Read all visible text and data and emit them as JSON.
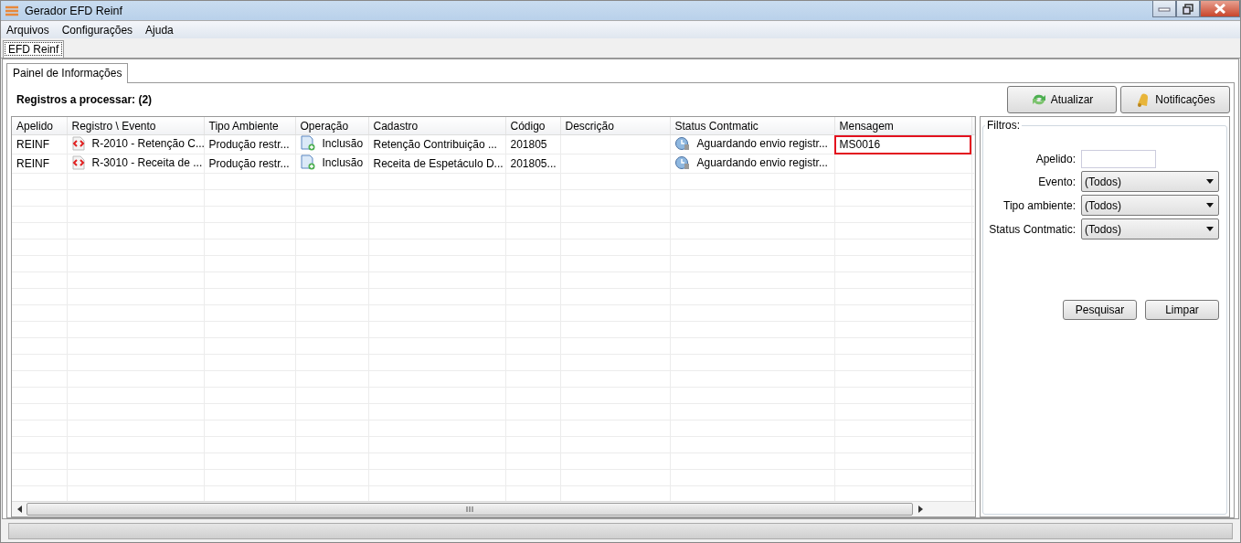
{
  "window": {
    "title": "Gerador EFD Reinf"
  },
  "menu": [
    "Arquivos",
    "Configurações",
    "Ajuda"
  ],
  "outer_tabs": [
    {
      "label": "EFD Reinf",
      "selected": true
    }
  ],
  "inner_tabs": [
    {
      "label": "Painel de Informações",
      "selected": true
    }
  ],
  "records_label": "Registros a processar: (2)",
  "toolbar_buttons": [
    {
      "label": "Atualizar",
      "kind": "refresh"
    },
    {
      "label": "Notificações",
      "kind": "bell"
    }
  ],
  "table": {
    "columns": [
      "Apelido",
      "Registro \\ Evento",
      "Tipo Ambiente",
      "Operação",
      "Cadastro",
      "Código",
      "Descrição",
      "Status Contmatic",
      "Mensagem"
    ],
    "rows": [
      {
        "apelido": "REINF",
        "registro": "R-2010 - Retenção C...",
        "tipo_ambiente": "Produção restr...",
        "operacao": "Inclusão",
        "cadastro": "Retenção Contribuição ...",
        "codigo": "201805",
        "status": "Aguardando envio registr...",
        "mensagem": "MS0016",
        "mensagem_outlined": true
      },
      {
        "apelido": "REINF",
        "registro": "R-3010 - Receita de ...",
        "tipo_ambiente": "Produção restr...",
        "operacao": "Inclusão",
        "cadastro": "Receita de Espetáculo D...",
        "codigo": "201805...",
        "status": "Aguardando envio registr...",
        "mensagem_outlined": false
      }
    ]
  },
  "filters": {
    "title": "Filtros:",
    "fields": [
      {
        "label": "Apelido:",
        "kind": "text"
      },
      {
        "label": "Evento:",
        "kind": "select",
        "value": "(Todos)"
      },
      {
        "label": "Tipo ambiente:",
        "kind": "select",
        "value": "(Todos)"
      },
      {
        "label": "Status Contmatic:",
        "kind": "select",
        "value": "(Todos)"
      }
    ],
    "buttons": [
      "Pesquisar",
      "Limpar"
    ]
  }
}
